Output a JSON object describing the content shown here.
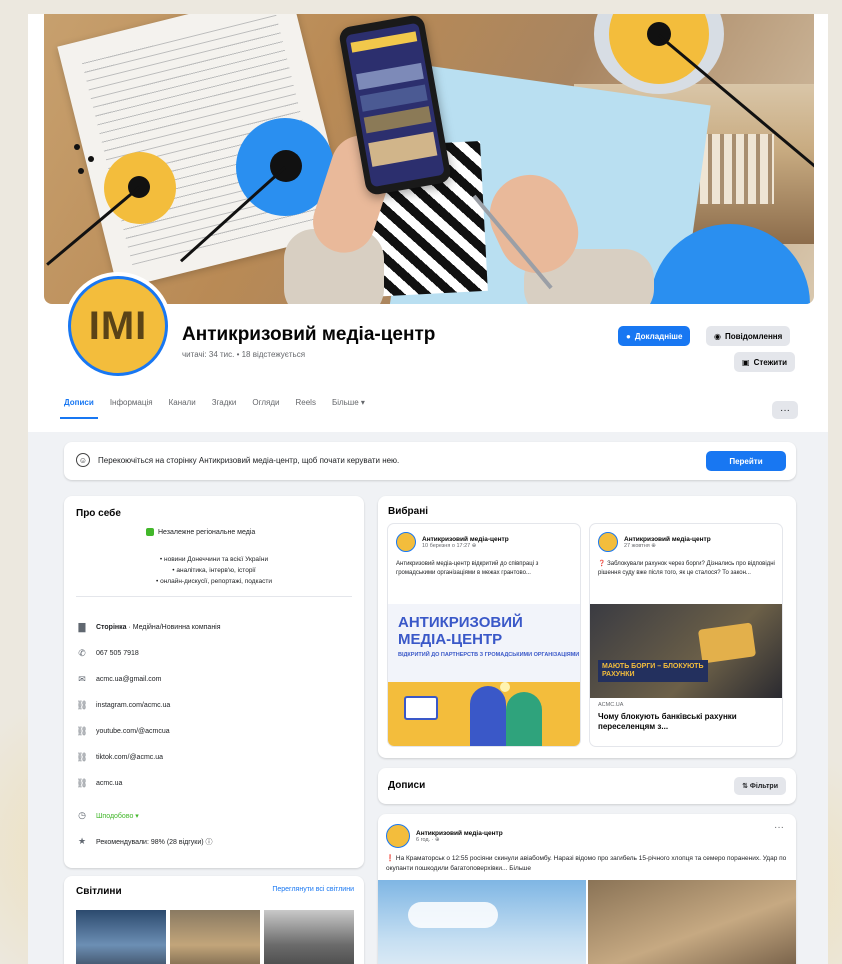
{
  "page": {
    "name": "Антикризовий медіа-центр",
    "meta": "читачі: 34 тис. • 18 відстежується",
    "avatar_letters": "IMI"
  },
  "actions": {
    "ads": "Докладніше",
    "message": "Повідомлення",
    "save": "Стежити",
    "more": "···"
  },
  "tabs": [
    "Дописи",
    "Інформація",
    "Канали",
    "Згадки",
    "Огляди",
    "Reels",
    "Більше ▾"
  ],
  "switch_bar": {
    "text": "Перекоючіться на сторінку Антикризовий медіа-центр, щоб почати керувати нею.",
    "button": "Перейти"
  },
  "about": {
    "title": "Про себе",
    "badge": "Незалежне регіональне медіа",
    "bullets": [
      "• новини Донеччини та всієї України",
      "• аналітика, інтерв'ю, історії",
      "• онлайн-дискусії, репортажі, подкасти"
    ],
    "rows": [
      {
        "icon": "▇",
        "icon_name": "page-icon",
        "bold": "Сторінка",
        "text": " · Медійна/Новинна компанія"
      },
      {
        "icon": "✆",
        "icon_name": "phone-icon",
        "bold": "",
        "text": "067 505 7918"
      },
      {
        "icon": "✉",
        "icon_name": "email-icon",
        "bold": "",
        "text": "acmc.ua@gmail.com"
      },
      {
        "icon": "⛓",
        "icon_name": "link-icon",
        "bold": "",
        "text": "instagram.com/acmc.ua"
      },
      {
        "icon": "⛓",
        "icon_name": "link-icon",
        "bold": "",
        "text": "youtube.com/@acmcua"
      },
      {
        "icon": "⛓",
        "icon_name": "link-icon",
        "bold": "",
        "text": "tiktok.com/@acmc.ua"
      },
      {
        "icon": "⛓",
        "icon_name": "link-icon",
        "bold": "",
        "text": "acmc.ua"
      },
      {
        "icon": "◷",
        "icon_name": "clock-icon",
        "bold": "",
        "text": "Шподобово ▾"
      },
      {
        "icon": "★",
        "icon_name": "star-icon",
        "bold": "",
        "text": "Рекомендували: 98% (28 відгуки) ⓘ"
      }
    ]
  },
  "photos": {
    "title": "Світлини",
    "link": "Переглянути всі світлини"
  },
  "featured": {
    "title": "Вибрані",
    "cards": [
      {
        "name": "Антикризовий медіа-центр",
        "time": "10 березня о 17:27 ⊕",
        "text": "Антикризовий медіа-центр відкритий до співпраці з громадськими організаціями в межах грантово...",
        "img_big": "АНТИКРИЗОВИЙ МЕДІА-ЦЕНТР",
        "img_small": "ВІДКРИТИЙ ДО ПАРТНЕРСТВ З ГРОМАДСЬКИМИ ОРГАНІЗАЦІЯМИ"
      },
      {
        "name": "Антикризовий медіа-центр",
        "time": "27 жовтня ⊕",
        "text": "❓ Заблокували рахунок через борги? Дізнались про відповідні рішення суду вже після того, як це сталося? То закон...",
        "banner": "МАЮТЬ БОРГИ – БЛОКУЮТЬ РАХУНКИ",
        "source": "ACMC.UA",
        "caption": "Чому блокують банківські рахунки переселенцям з..."
      }
    ]
  },
  "posts": {
    "title": "Дописи",
    "filter": "⇅ Фільтри",
    "post": {
      "name": "Антикризовий медіа-центр",
      "time": "6 год. · ⊕",
      "text_pre": "❗",
      "text": " На Краматорськ о 12:55 росіяни скинули авіабомбу. Наразі відомо про загибель 15-річного хлопця та семеро поранених. Удар по окупанти пошкодили багатоповерхівки... Більше",
      "dots": "···"
    }
  },
  "colors": {
    "accent": "#1877f2",
    "brand_yellow": "#f3bd3c",
    "bg": "#f0f2f5"
  }
}
